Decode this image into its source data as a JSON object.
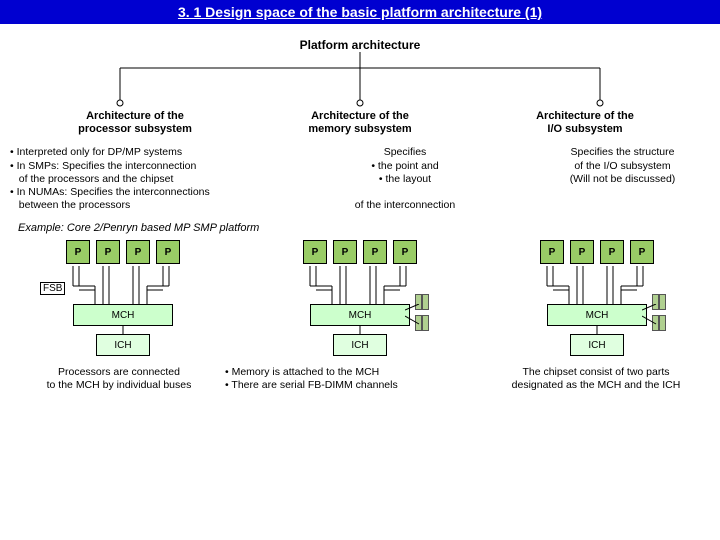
{
  "title": "3. 1 Design space of the basic platform architecture (1)",
  "root": "Platform architecture",
  "sub1": {
    "l1": "Architecture of the",
    "l2": "processor subsystem"
  },
  "sub2": {
    "l1": "Architecture of the",
    "l2": "memory subsystem"
  },
  "sub3": {
    "l1": "Architecture of the",
    "l2": "I/O subsystem"
  },
  "desc1": {
    "b1": "Interpreted only for DP/MP systems",
    "b2": "In SMPs: Specifies the interconnection",
    "b2b": "of the processors and the chipset",
    "b3": "In NUMAs: Specifies the interconnections",
    "b3b": "between the processors"
  },
  "desc2": {
    "t1": "Specifies",
    "t2": "• the point and",
    "t3": "• the layout",
    "t4": "of the interconnection"
  },
  "desc3": {
    "t1": "Specifies the structure",
    "t2": "of the I/O subsystem",
    "t3": "(Will not be discussed)"
  },
  "example": "Example: Core 2/Penryn based MP SMP platform",
  "p": "P",
  "fsb": "FSB",
  "mch": "MCH",
  "ich": "ICH",
  "cap1": {
    "l1": "Processors are connected",
    "l2": "to the MCH by individual buses"
  },
  "cap2": {
    "l1": "• Memory is attached to the MCH",
    "l2": "• There are serial FB-DIMM channels"
  },
  "cap3": {
    "l1": "The chipset consist of two parts",
    "l2": "designated as the MCH and the ICH"
  }
}
